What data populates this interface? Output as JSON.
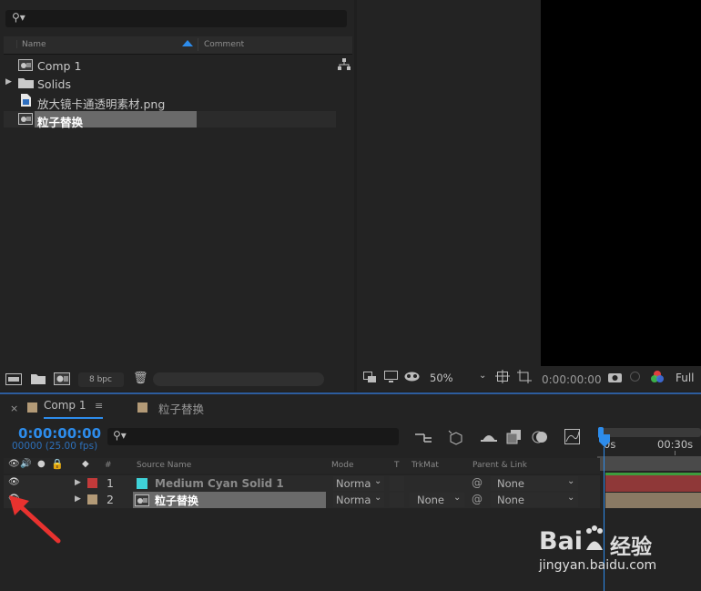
{
  "project": {
    "search_placeholder": "",
    "col_name": "Name",
    "col_comment": "Comment",
    "items": [
      {
        "label": "Comp 1",
        "type": "composition"
      },
      {
        "label": "Solids",
        "type": "folder"
      },
      {
        "label": "放大镜卡通透明素材.png",
        "type": "image"
      },
      {
        "label": "粒子替换",
        "type": "composition",
        "selected": true
      }
    ],
    "bpc": "8 bpc"
  },
  "viewer": {
    "zoom": "50%",
    "timecode": "0:00:00:00",
    "resolution": "Full"
  },
  "timeline": {
    "tabs": [
      {
        "label": "Comp 1",
        "swatch": "#b39a77"
      },
      {
        "label": "粒子替换",
        "swatch": "#b39a77"
      }
    ],
    "current_time": "0:00:00:00",
    "frame_info": "00000 (25.00 fps)",
    "search_placeholder": "",
    "headers": {
      "num": "#",
      "source_name": "Source Name",
      "mode": "Mode",
      "t": "T",
      "trkmat": "TrkMat",
      "parent": "Parent & Link"
    },
    "ruler": {
      "start": "0s",
      "mark": "00:30s"
    },
    "layers": [
      {
        "num": "1",
        "name": "Medium Cyan Solid 1",
        "label_color": "#c23a3a",
        "icon_color": "#3fd2d8",
        "mode": "Norma",
        "trkmat": "",
        "parent": "None",
        "bar_color": "#8f3838"
      },
      {
        "num": "2",
        "name": "粒子替换",
        "label_color": "#b39a77",
        "icon_color": "#8a8a8a",
        "mode": "Norma",
        "trkmat": "None",
        "parent": "None",
        "bar_color": "#8a7a64",
        "selected": true
      }
    ]
  },
  "watermark": {
    "brand": "Bai",
    "brand2": "经验",
    "url": "jingyan.baidu.com"
  },
  "colors": {
    "accent_blue": "#2d8ceb",
    "selection": "#6a6a6a",
    "annotation_arrow": "#e8322f"
  }
}
